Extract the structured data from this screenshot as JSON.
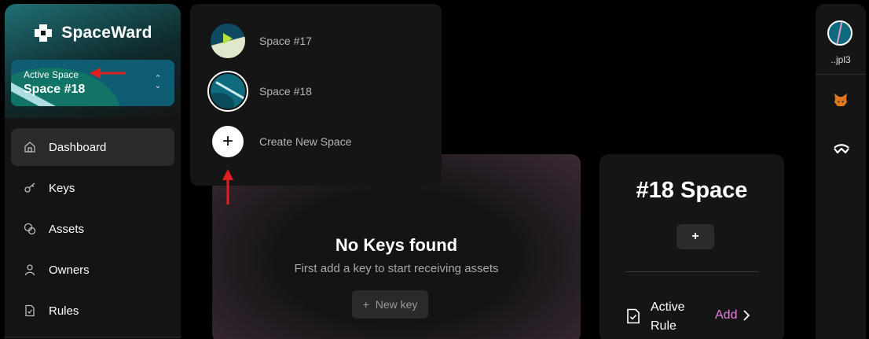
{
  "app": {
    "name": "SpaceWard"
  },
  "active_space": {
    "label": "Active Space",
    "name": "Space #18"
  },
  "nav": {
    "items": [
      {
        "label": "Dashboard",
        "icon": "home-icon",
        "active": true
      },
      {
        "label": "Keys",
        "icon": "key-icon",
        "active": false
      },
      {
        "label": "Assets",
        "icon": "coins-icon",
        "active": false
      },
      {
        "label": "Owners",
        "icon": "user-icon",
        "active": false
      },
      {
        "label": "Rules",
        "icon": "rule-icon",
        "active": false
      }
    ]
  },
  "space_menu": {
    "items": [
      {
        "label": "Space #17"
      },
      {
        "label": "Space #18",
        "selected": true
      },
      {
        "label": "Create New Space"
      }
    ]
  },
  "main": {
    "empty_title": "No Keys found",
    "empty_subtitle": "First add a key to start receiving assets",
    "new_key_label": "New key",
    "new_key_icon": "+"
  },
  "space_panel": {
    "title": "#18 Space",
    "add_button": "+",
    "rule_label": "Active Rule",
    "rule_action": "Add",
    "rule_action_color": "#e97de3"
  },
  "account": {
    "address": "..jpl3",
    "wallets": [
      "metamask-icon",
      "walletconnect-icon"
    ]
  },
  "annotations": {
    "arrow_color": "#e02020"
  }
}
